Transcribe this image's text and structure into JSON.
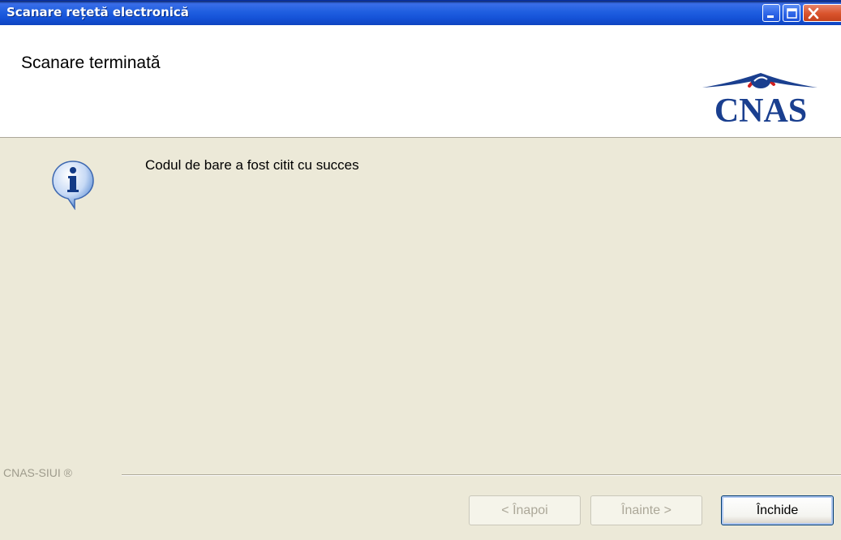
{
  "window": {
    "title": "Scanare rețetă electronică",
    "controls": {
      "minimize": "minimize-icon",
      "maximize": "maximize-icon",
      "close": "close-icon"
    }
  },
  "header": {
    "heading": "Scanare terminată",
    "logo_text": "CNAS"
  },
  "content": {
    "icon": "info-icon",
    "message": "Codul de bare a fost citit cu succes"
  },
  "footer": {
    "label": "CNAS-SIUI ®"
  },
  "buttons": {
    "back": "< Înapoi",
    "next": "Înainte >",
    "close": "Închide"
  },
  "colors": {
    "titlebar": "#1f5fe0",
    "dialog_bg": "#ece9d8",
    "logo_blue": "#1a3f8f",
    "logo_red": "#d11f1f"
  }
}
